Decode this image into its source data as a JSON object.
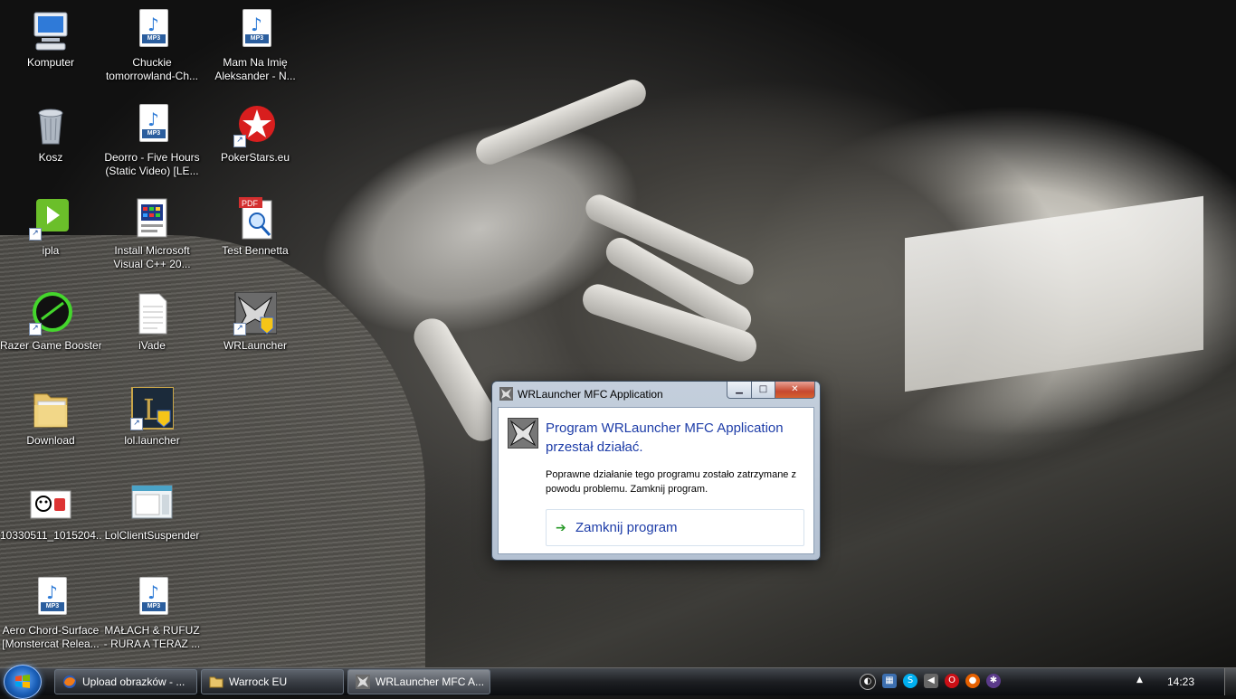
{
  "desktop": {
    "icons": [
      {
        "label": "Komputer",
        "icon": "computer-icon"
      },
      {
        "label": "Chuckie tomorrowland-Ch...",
        "icon": "mp3-file-icon"
      },
      {
        "label": "Mam Na Imię Aleksander - N...",
        "icon": "mp3-file-icon"
      },
      {
        "label": "Kosz",
        "icon": "recycle-bin-icon"
      },
      {
        "label": "Deorro - Five Hours (Static Video) [LE...",
        "icon": "mp3-file-icon"
      },
      {
        "label": "PokerStars.eu",
        "icon": "pokerstars-icon"
      },
      {
        "label": "ipla",
        "icon": "ipla-icon"
      },
      {
        "label": "Install Microsoft Visual C++ 20...",
        "icon": "installer-icon"
      },
      {
        "label": "Test Bennetta",
        "icon": "pdf-file-icon"
      },
      {
        "label": "Razer Game Booster",
        "icon": "razer-icon"
      },
      {
        "label": "iVade",
        "icon": "text-file-icon"
      },
      {
        "label": "WRLauncher",
        "icon": "wrlauncher-icon"
      },
      {
        "label": "Download",
        "icon": "folder-icon"
      },
      {
        "label": "lol.launcher",
        "icon": "lol-launcher-icon"
      },
      {
        "label": "10330511_1015204...",
        "icon": "image-file-icon"
      },
      {
        "label": "LolClientSuspender",
        "icon": "app-window-icon"
      },
      {
        "label": "Aero Chord-Surface [Monstercat Relea...",
        "icon": "mp3-file-icon"
      },
      {
        "label": "MAŁACH & RUFUZ - RURA A TERAZ ...",
        "icon": "mp3-file-icon"
      }
    ],
    "mp3_tag": "MP3",
    "pdf_tag": "PDF"
  },
  "dialog": {
    "title": "WRLauncher MFC Application",
    "heading": "Program WRLauncher MFC Application przestał działać.",
    "message": "Poprawne działanie tego programu zostało zatrzymane z powodu problemu. Zamknij program.",
    "action_label": "Zamknij program",
    "minimize_glyph": "▁",
    "maximize_glyph": "□",
    "close_glyph": "✕"
  },
  "taskbar": {
    "buttons": [
      {
        "label": "Upload obrazków - ...",
        "icon": "firefox-icon",
        "active": false
      },
      {
        "label": "Warrock EU",
        "icon": "folder-icon",
        "active": false
      },
      {
        "label": "WRLauncher MFC A...",
        "icon": "wrlauncher-icon",
        "active": true
      }
    ],
    "tray_icons": [
      "steam-icon",
      "network-icon",
      "skype-icon",
      "speaker-icon",
      "opera-icon",
      "firefox-icon",
      "razer-icon"
    ],
    "show_hidden_glyph": "▲",
    "clock": "14:23"
  },
  "colors": {
    "dialog_heading": "#1e3da8",
    "close_button": "#c7482e"
  }
}
